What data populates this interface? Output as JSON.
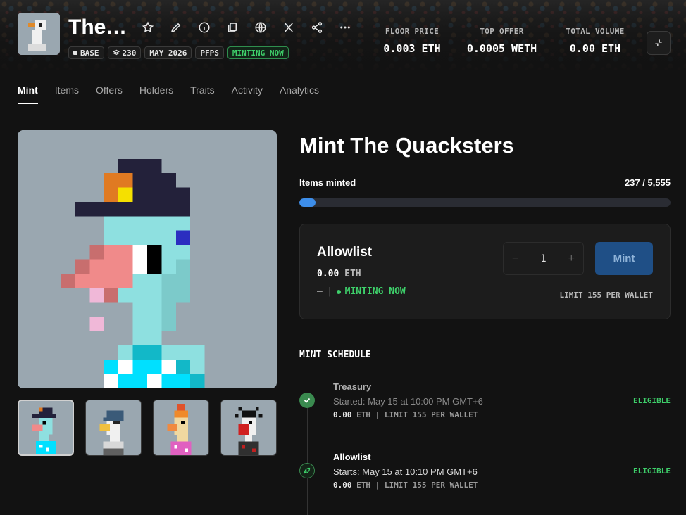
{
  "header": {
    "title": "The Quacksters",
    "title_display": "The",
    "title_ellipsis": "…",
    "tags": {
      "chain": "BASE",
      "items": "230",
      "date": "MAY 2026",
      "category": "PFPS",
      "status": "MINTING NOW"
    },
    "stats": [
      {
        "label": "FLOOR PRICE",
        "value": "0.003 ETH"
      },
      {
        "label": "TOP OFFER",
        "value": "0.0005 WETH"
      },
      {
        "label": "TOTAL VOLUME",
        "value": "0.00 ETH"
      }
    ],
    "icons": [
      "star-icon",
      "pencil-icon",
      "info-icon",
      "copy-icon",
      "globe-icon",
      "x-icon",
      "share-icon",
      "more-icon"
    ]
  },
  "tabs": [
    "Mint",
    "Items",
    "Offers",
    "Holders",
    "Traits",
    "Activity",
    "Analytics"
  ],
  "mint": {
    "title": "Mint The Quacksters",
    "minted_label": "Items minted",
    "minted_value": "237 / 5,555",
    "progress_fraction": 0.0427,
    "phase": {
      "name": "Allowlist",
      "price": "0.00",
      "unit": "ETH",
      "dash": "–",
      "status": "MINTING NOW",
      "quantity": "1",
      "minus": "−",
      "plus": "+",
      "button": "Mint",
      "limit": "LIMIT 155 PER WALLET"
    }
  },
  "schedule": {
    "title": "MINT SCHEDULE",
    "items": [
      {
        "name": "Treasury",
        "time": "Started: May 15 at 10:00 PM GMT+6",
        "price": "0.00",
        "rest": " ETH | LIMIT 155 PER WALLET",
        "eligibility": "ELIGIBLE"
      },
      {
        "name": "Allowlist",
        "time": "Starts: May 15 at 10:10 PM GMT+6",
        "price": "0.00",
        "rest": " ETH | LIMIT 155 PER WALLET",
        "eligibility": "ELIGIBLE"
      }
    ]
  },
  "colors": {
    "accent": "#3d8eea",
    "live_green": "#3ecf6a",
    "art_bg": "#9aa7b0"
  }
}
